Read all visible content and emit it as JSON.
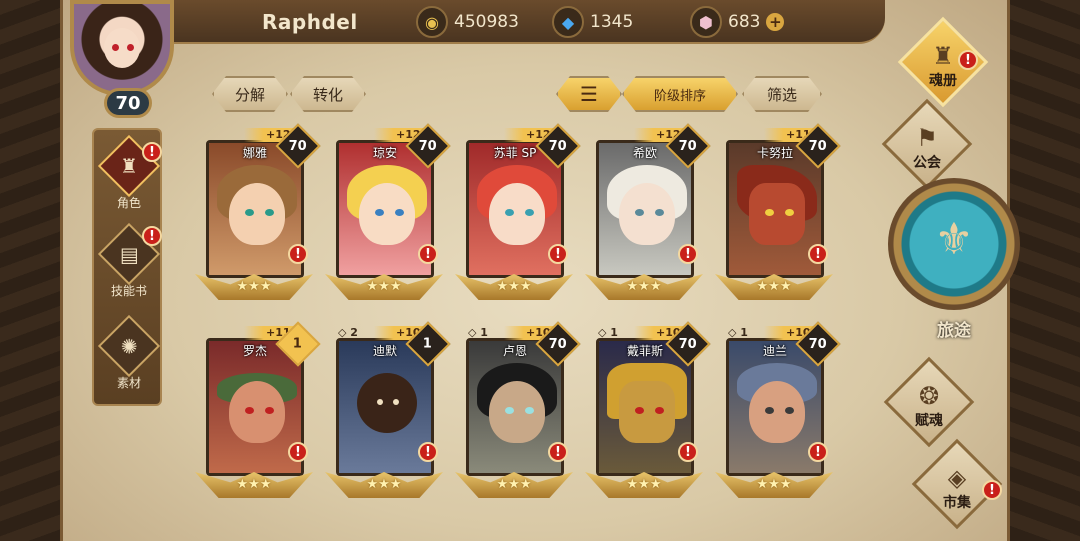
{
  "player": {
    "name": "Raphdel",
    "level": "70"
  },
  "resources": {
    "gold": {
      "icon": "gold-coin-icon",
      "value": "450983"
    },
    "crystal": {
      "icon": "blue-crystal-icon",
      "value": "1345"
    },
    "gem": {
      "icon": "pink-gem-icon",
      "value": "683"
    },
    "plus": "+"
  },
  "left_menu": [
    {
      "label": "角色",
      "icon": "helmet-icon",
      "alert": "!"
    },
    {
      "label": "技能书",
      "icon": "book-icon",
      "alert": "!"
    },
    {
      "label": "素材",
      "icon": "material-icon"
    }
  ],
  "filters": {
    "decompose": "分解",
    "convert": "转化",
    "sort_icon": "sort-icon",
    "rank_sort": "阶级排序",
    "filter": "筛选"
  },
  "cards": [
    {
      "name": "娜雅",
      "plus": "+12",
      "level": "70",
      "stars": "★★★",
      "alert": "!"
    },
    {
      "name": "琼安",
      "plus": "+12",
      "level": "70",
      "stars": "★★★",
      "alert": "!"
    },
    {
      "name": "苏菲 SP",
      "plus": "+12",
      "level": "70",
      "stars": "★★★",
      "alert": "!"
    },
    {
      "name": "希欧",
      "plus": "+12",
      "level": "70",
      "stars": "★★★",
      "alert": "!"
    },
    {
      "name": "卡努拉",
      "plus": "+11",
      "level": "70",
      "stars": "★★★",
      "alert": "!"
    },
    {
      "name": "罗杰",
      "plus": "+11",
      "level": "1",
      "stars": "★★★",
      "alert": "!"
    },
    {
      "name": "迪默",
      "rank": "◇ 2",
      "plus": "+10",
      "level": "1",
      "stars": "★★★",
      "alert": "!"
    },
    {
      "name": "卢恩",
      "rank": "◇ 1",
      "plus": "+10",
      "level": "70",
      "stars": "★★★",
      "alert": "!"
    },
    {
      "name": "戴菲斯",
      "rank": "◇ 1",
      "plus": "+10",
      "level": "70",
      "stars": "★★★",
      "alert": "!"
    },
    {
      "name": "迪兰",
      "rank": "◇ 1",
      "plus": "+10",
      "level": "70",
      "stars": "★★★",
      "alert": "!"
    }
  ],
  "right_nav": {
    "soul_book": {
      "label": "魂册",
      "icon": "helmet-icon",
      "alert": "!"
    },
    "guild": {
      "label": "公会",
      "icon": "guild-icon"
    },
    "journey": {
      "label": "旅途",
      "icon": "journey-emblem-icon"
    },
    "soul": {
      "label": "赋魂",
      "icon": "flame-icon"
    },
    "market": {
      "label": "市集",
      "icon": "crate-icon",
      "alert": "!"
    }
  },
  "colors": {
    "accent_gold": "#f2c250",
    "alert_red": "#c9201a",
    "parchment": "#e8dcc0"
  }
}
